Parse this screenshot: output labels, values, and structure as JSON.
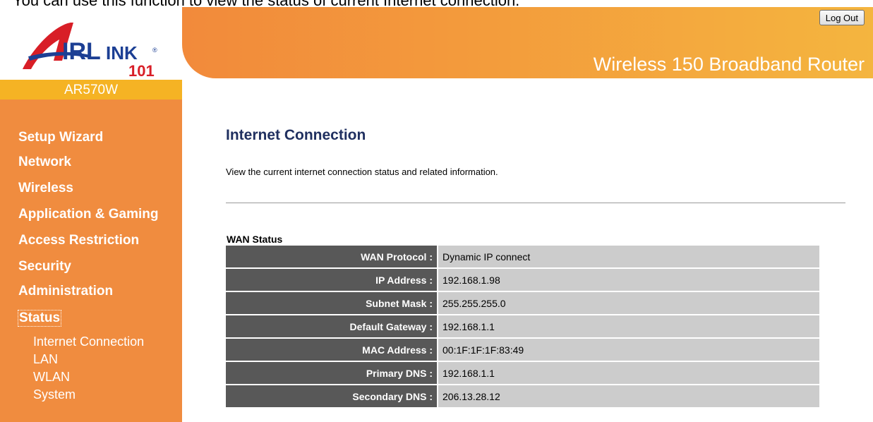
{
  "caption": "You can use this function to view the status of current Internet connection.",
  "header": {
    "logout_label": "Log Out",
    "router_name": "Wireless 150 Broadband Router"
  },
  "logo": {
    "text": "AirLink 101",
    "colors": {
      "red": "#d81e27",
      "blue": "#1c3f94"
    }
  },
  "model": "AR570W",
  "sidebar": {
    "items": [
      {
        "label": "Setup Wizard"
      },
      {
        "label": "Network"
      },
      {
        "label": "Wireless"
      },
      {
        "label": "Application & Gaming"
      },
      {
        "label": "Access Restriction"
      },
      {
        "label": "Security"
      },
      {
        "label": "Administration"
      },
      {
        "label": "Status",
        "active": true
      }
    ],
    "subitems": [
      {
        "label": "Internet Connection"
      },
      {
        "label": "LAN"
      },
      {
        "label": "WLAN"
      },
      {
        "label": "System"
      }
    ]
  },
  "main": {
    "title": "Internet Connection",
    "description": "View the current internet connection status and related information.",
    "section_title": "WAN Status",
    "rows": [
      {
        "label": "WAN Protocol :",
        "value": "Dynamic IP connect"
      },
      {
        "label": "IP Address :",
        "value": "192.168.1.98"
      },
      {
        "label": "Subnet Mask :",
        "value": "255.255.255.0"
      },
      {
        "label": "Default Gateway :",
        "value": "192.168.1.1"
      },
      {
        "label": "MAC Address :",
        "value": "00:1F:1F:1F:83:49"
      },
      {
        "label": "Primary DNS :",
        "value": "192.168.1.1"
      },
      {
        "label": "Secondary DNS :",
        "value": "206.13.28.12"
      }
    ]
  },
  "colors": {
    "sidebar": "#f08c3f",
    "model_bar": "#f5b324",
    "title": "#203060",
    "label_cell": "#585858",
    "value_cell": "#cccccc"
  }
}
